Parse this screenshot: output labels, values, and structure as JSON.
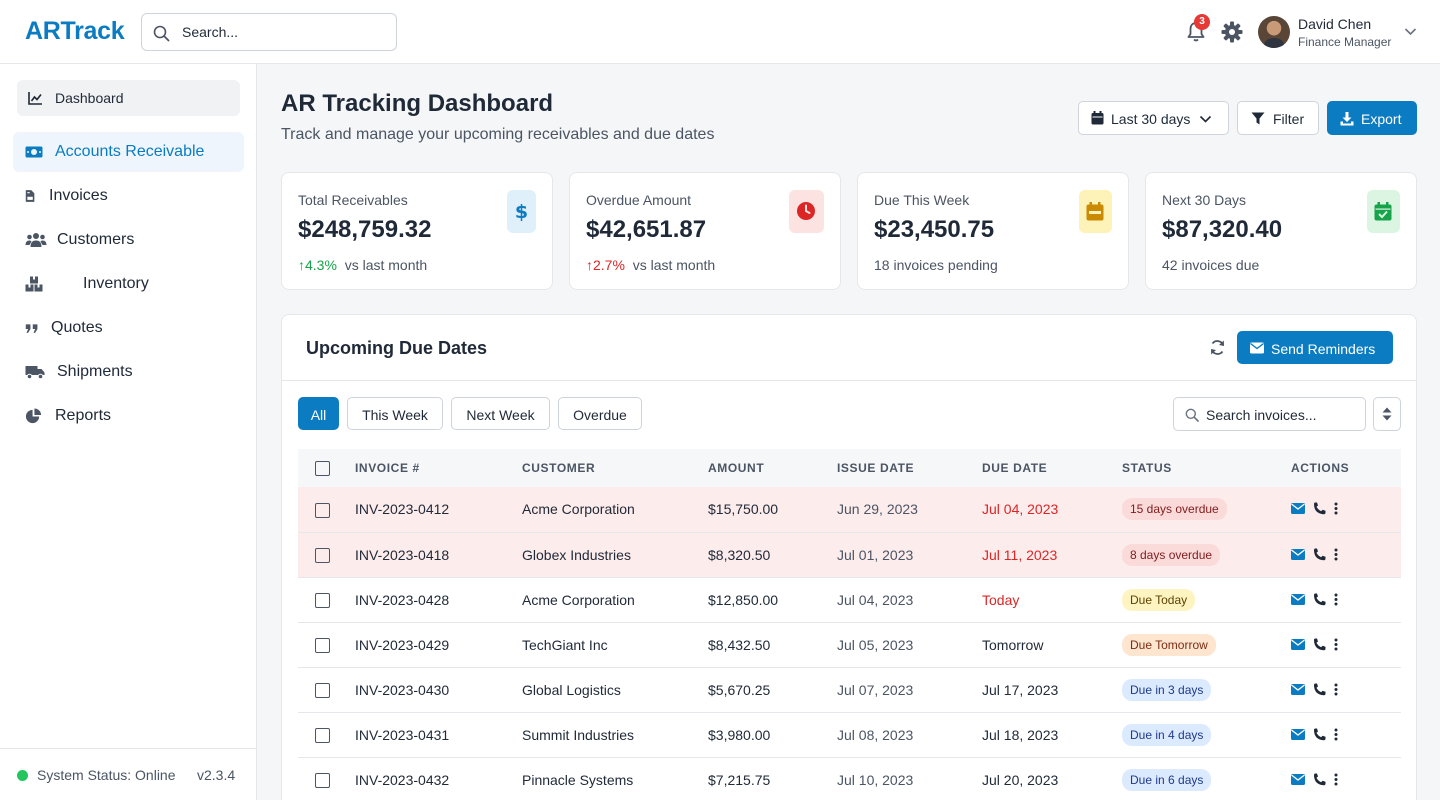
{
  "header": {
    "logo": "ARTrack",
    "search_placeholder": "Search...",
    "notification_count": "3",
    "user_name": "David Chen",
    "user_role": "Finance Manager"
  },
  "sidebar": {
    "items": [
      {
        "label": "Dashboard",
        "icon": "chart-line-icon"
      },
      {
        "label": "Accounts Receivable",
        "icon": "money-bill-icon",
        "active": true
      },
      {
        "label": "Invoices",
        "icon": "file-invoice-icon"
      },
      {
        "label": "Customers",
        "icon": "users-icon"
      },
      {
        "label": "Inventory",
        "icon": "boxes-icon"
      },
      {
        "label": "Quotes",
        "icon": "quote-icon"
      },
      {
        "label": "Shipments",
        "icon": "truck-icon"
      },
      {
        "label": "Reports",
        "icon": "pie-chart-icon"
      }
    ],
    "status": "System Status: Online",
    "version": "v2.3.4"
  },
  "main": {
    "title": "AR Tracking Dashboard",
    "subtitle": "Track and manage your upcoming receivables and due dates",
    "range_label": "Last 30 days",
    "filter_label": "Filter",
    "export_label": "Export"
  },
  "stats": [
    {
      "label": "Total Receivables",
      "value": "$248,759.32",
      "trend": "4.3%",
      "trend_dir": "up",
      "trend_note": "vs last month",
      "color": "#0b7cc1"
    },
    {
      "label": "Overdue Amount",
      "value": "$42,651.87",
      "trend": "2.7%",
      "trend_dir": "up-bad",
      "trend_note": "vs last month",
      "color": "#dc2626"
    },
    {
      "label": "Due This Week",
      "value": "$23,450.75",
      "note": "18 invoices pending",
      "color": "#ca8a04"
    },
    {
      "label": "Next 30 Days",
      "value": "$87,320.40",
      "note": "42 invoices due",
      "color": "#16a34a"
    }
  ],
  "panel": {
    "title": "Upcoming Due Dates",
    "send_label": "Send Reminders",
    "tabs": [
      "All",
      "This Week",
      "Next Week",
      "Overdue"
    ],
    "search_placeholder": "Search invoices..."
  },
  "table": {
    "columns": [
      "INVOICE #",
      "CUSTOMER",
      "AMOUNT",
      "ISSUE DATE",
      "DUE DATE",
      "STATUS",
      "ACTIONS"
    ],
    "rows": [
      {
        "invoice": "INV-2023-0412",
        "customer": "Acme Corporation",
        "amount": "$15,750.00",
        "issue": "Jun 29, 2023",
        "due": "Jul 04, 2023",
        "status": "15 days overdue",
        "tone": "red"
      },
      {
        "invoice": "INV-2023-0418",
        "customer": "Globex Industries",
        "amount": "$8,320.50",
        "issue": "Jul 01, 2023",
        "due": "Jul 11, 2023",
        "status": "8 days overdue",
        "tone": "red"
      },
      {
        "invoice": "INV-2023-0428",
        "customer": "Acme Corporation",
        "amount": "$12,850.00",
        "issue": "Jul 04, 2023",
        "due": "Today",
        "status": "Due Today",
        "tone": "yellow"
      },
      {
        "invoice": "INV-2023-0429",
        "customer": "TechGiant Inc",
        "amount": "$8,432.50",
        "issue": "Jul 05, 2023",
        "due": "Tomorrow",
        "status": "Due Tomorrow",
        "tone": "orange"
      },
      {
        "invoice": "INV-2023-0430",
        "customer": "Global Logistics",
        "amount": "$5,670.25",
        "issue": "Jul 07, 2023",
        "due": "Jul 17, 2023",
        "status": "Due in 3 days",
        "tone": "blue"
      },
      {
        "invoice": "INV-2023-0431",
        "customer": "Summit Industries",
        "amount": "$3,980.00",
        "issue": "Jul 08, 2023",
        "due": "Jul 18, 2023",
        "status": "Due in 4 days",
        "tone": "blue"
      },
      {
        "invoice": "INV-2023-0432",
        "customer": "Pinnacle Systems",
        "amount": "$7,215.75",
        "issue": "Jul 10, 2023",
        "due": "Jul 20, 2023",
        "status": "Due in 6 days",
        "tone": "blue"
      }
    ]
  },
  "colors": {
    "brand": "#0b7cc1",
    "danger": "#dc2626",
    "success": "#16a34a"
  }
}
